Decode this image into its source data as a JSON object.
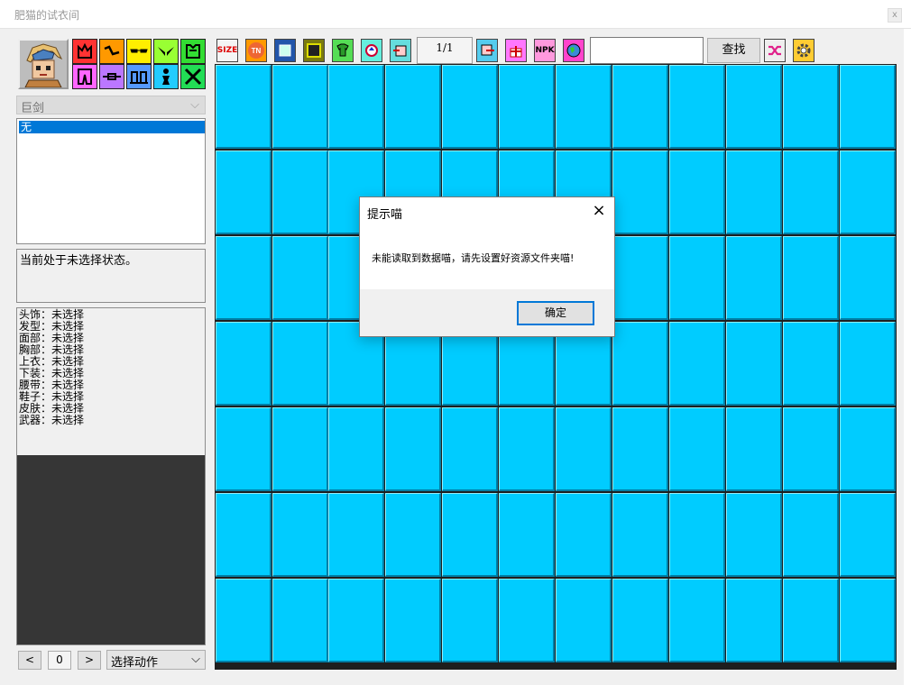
{
  "window": {
    "title": "肥猫的试衣间",
    "close_label": "x"
  },
  "left_panel": {
    "category_icons": [
      "hat-icon",
      "hair-icon",
      "face-icon",
      "chest-icon",
      "top-icon",
      "pants-icon",
      "belt-icon",
      "shoes-icon",
      "skin-icon",
      "weapon-icon"
    ],
    "weapon_select": {
      "value": "巨剑"
    },
    "item_list": {
      "items": [
        "无"
      ]
    },
    "status_text": "当前处于未选择状态。",
    "parts": [
      "头饰：未选择",
      "发型：未选择",
      "面部：未选择",
      "胸部：未选择",
      "上衣：未选择",
      "下装：未选择",
      "腰带：未选择",
      "鞋子：未选择",
      "皮肤：未选择",
      "武器：未选择"
    ],
    "frame_controls": {
      "prev": "<",
      "frame": "0",
      "next": ">",
      "action": "选择动作"
    }
  },
  "toolbar": {
    "icons": [
      "size-icon",
      "tn-icon",
      "frame-icon",
      "border-icon",
      "shirt-export-icon",
      "refresh-icon",
      "import-icon",
      "export-icon",
      "gift-icon",
      "npk-icon",
      "globe-icon"
    ],
    "page_indicator": "1/1",
    "search_value": "",
    "search_button": "查找",
    "shuffle_icon": "shuffle-icon",
    "settings_icon": "gear-icon"
  },
  "grid": {
    "rows": 7,
    "cols": 12,
    "cell_color": "#00ccff"
  },
  "dialog": {
    "title": "提示喵",
    "message": "未能读取到数据喵，请先设置好资源文件夹喵!",
    "ok_button": "确定",
    "close_icon": "×"
  },
  "colors": {
    "accent": "#0078d7",
    "grid_cell": "#00ccff"
  }
}
